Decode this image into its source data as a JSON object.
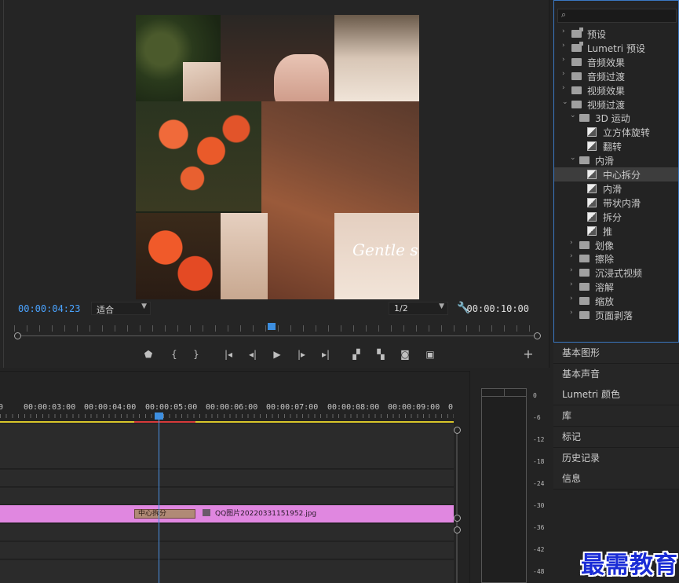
{
  "monitor": {
    "current_timecode": "00:00:04:23",
    "duration_timecode": "00:00:10:00",
    "zoom_select": "适合",
    "resolution_select": "1/2",
    "preview_overlay_text": "Gentle su"
  },
  "effects": {
    "tree": [
      {
        "label": "预设",
        "level": 0,
        "kind": "bin",
        "expanded": false
      },
      {
        "label": "Lumetri 预设",
        "level": 0,
        "kind": "bin",
        "expanded": false
      },
      {
        "label": "音频效果",
        "level": 0,
        "kind": "folder",
        "expanded": false
      },
      {
        "label": "音频过渡",
        "level": 0,
        "kind": "folder",
        "expanded": false
      },
      {
        "label": "视频效果",
        "level": 0,
        "kind": "folder",
        "expanded": false
      },
      {
        "label": "视频过渡",
        "level": 0,
        "kind": "folder",
        "expanded": true
      },
      {
        "label": "3D 运动",
        "level": 1,
        "kind": "folder",
        "expanded": true
      },
      {
        "label": "立方体旋转",
        "level": 2,
        "kind": "effect"
      },
      {
        "label": "翻转",
        "level": 2,
        "kind": "effect"
      },
      {
        "label": "内滑",
        "level": 1,
        "kind": "folder",
        "expanded": true
      },
      {
        "label": "中心拆分",
        "level": 2,
        "kind": "effect",
        "selected": true
      },
      {
        "label": "内滑",
        "level": 2,
        "kind": "effect"
      },
      {
        "label": "带状内滑",
        "level": 2,
        "kind": "effect"
      },
      {
        "label": "拆分",
        "level": 2,
        "kind": "effect"
      },
      {
        "label": "推",
        "level": 2,
        "kind": "effect"
      },
      {
        "label": "划像",
        "level": 1,
        "kind": "folder",
        "expanded": false
      },
      {
        "label": "擦除",
        "level": 1,
        "kind": "folder",
        "expanded": false
      },
      {
        "label": "沉浸式视频",
        "level": 1,
        "kind": "folder",
        "expanded": false
      },
      {
        "label": "溶解",
        "level": 1,
        "kind": "folder",
        "expanded": false
      },
      {
        "label": "缩放",
        "level": 1,
        "kind": "folder",
        "expanded": false
      },
      {
        "label": "页面剥落",
        "level": 1,
        "kind": "folder",
        "expanded": false
      }
    ]
  },
  "panels": [
    "基本图形",
    "基本声音",
    "Lumetri 颜色",
    "库",
    "标记",
    "历史记录",
    "信息"
  ],
  "timeline": {
    "ruler_labels": [
      "0",
      "00:00:03:00",
      "00:00:04:00",
      "00:00:05:00",
      "00:00:06:00",
      "00:00:07:00",
      "00:00:08:00",
      "00:00:09:00",
      "0"
    ],
    "transition_label": "中心拆分",
    "clip_name": "QQ图片20220331151952.jpg"
  },
  "meters": {
    "db_labels": [
      "0",
      "-6",
      "-12",
      "-18",
      "-24",
      "-30",
      "-36",
      "-42",
      "-48"
    ]
  },
  "watermark": "最需教育",
  "colors": {
    "accent_blue": "#4aa3ff",
    "clip_pink": "#e087e0",
    "work_area_yellow": "#d9c62a",
    "render_red": "#d83a3a"
  }
}
